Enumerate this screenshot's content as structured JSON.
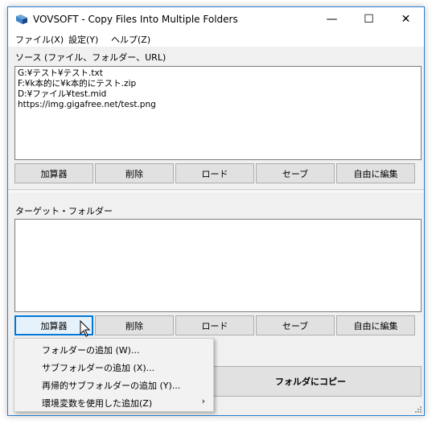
{
  "window": {
    "title": "VOVSOFT - Copy Files Into Multiple Folders",
    "minimize_glyph": "—",
    "maximize_glyph": "☐",
    "close_glyph": "✕"
  },
  "menu": {
    "file": "ファイル(X)",
    "settings": "設定(Y)",
    "help": "ヘルプ(Z)"
  },
  "source": {
    "label": "ソース (ファイル、フォルダー、URL)",
    "lines": [
      "G:¥テスト¥テスト.txt",
      "F:¥k本的に¥k本的にテスト.zip",
      "D:¥ファイル¥test.mid",
      "https://img.gigafree.net/test.png"
    ],
    "buttons": {
      "add": "加算器",
      "delete": "削除",
      "load": "ロード",
      "save": "セーブ",
      "edit": "自由に編集"
    }
  },
  "target": {
    "label": "ターゲット・フォルダー",
    "buttons": {
      "add": "加算器",
      "delete": "削除",
      "load": "ロード",
      "save": "セーブ",
      "edit": "自由に編集"
    }
  },
  "copy_button": "フォルダにコピー",
  "popup": {
    "items": [
      "フォルダーの追加 (W)...",
      "サブフォルダーの追加 (X)...",
      "再帰的サブフォルダーの追加 (Y)...",
      "環境変数を使用した追加(Z)"
    ],
    "submenu_arrow": "›"
  },
  "colors": {
    "accent": "#0078d7",
    "window_bg": "#f0f0f0",
    "button_bg": "#e1e1e1"
  }
}
